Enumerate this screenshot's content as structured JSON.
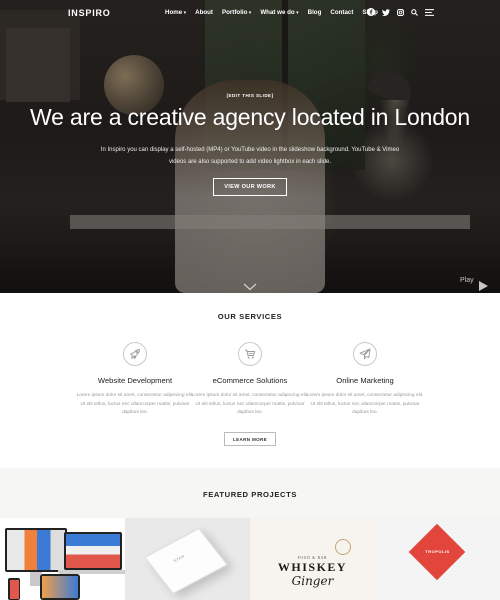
{
  "brand": {
    "logo_text": "INSPIRO"
  },
  "nav": {
    "items": [
      {
        "label": "Home",
        "dropdown": true
      },
      {
        "label": "About",
        "dropdown": false
      },
      {
        "label": "Portfolio",
        "dropdown": true
      },
      {
        "label": "What we do",
        "dropdown": true
      },
      {
        "label": "Blog",
        "dropdown": false
      },
      {
        "label": "Contact",
        "dropdown": false
      },
      {
        "label": "Shop",
        "dropdown": false
      }
    ],
    "icons": [
      "facebook-icon",
      "twitter-icon",
      "instagram-icon",
      "search-icon",
      "menu-icon"
    ]
  },
  "hero": {
    "edit_label": "[EDIT THIS SLIDE]",
    "title": "We are a creative agency located in London",
    "description": "In Inspiro you can display a self-hosted (MP4) or YouTube video in the slideshow background. YouTube & Vimeo videos are also supported to add video lightbox in each slide.",
    "button_label": "VIEW OUR WORK",
    "play_label": "Play"
  },
  "services": {
    "title": "OUR SERVICES",
    "items": [
      {
        "icon": "rocket-icon",
        "title": "Website Development",
        "text": "Lorem ipsum dolor sit amet, consectetur adipiscing elit. Ut elit tellus, luctus nec ullamcorper mattis, pulvinar dapibus leo."
      },
      {
        "icon": "cart-icon",
        "title": "eCommerce Solutions",
        "text": "Lorem ipsum dolor sit amet, consectetur adipiscing elit. Ut elit tellus, luctus nec ullamcorper mattis, pulvinar dapibus leo."
      },
      {
        "icon": "paper-plane-icon",
        "title": "Online Marketing",
        "text": "Lorem ipsum dolor sit amet, consectetur adipiscing elit. Ut elit tellus, luctus nec ullamcorper mattis, pulvinar dapibus leo."
      }
    ],
    "button_label": "LEARN MORE"
  },
  "featured": {
    "title": "FEATURED PROJECTS",
    "projects": [
      {
        "name": "devices-mockup"
      },
      {
        "name": "book-mockup",
        "label": "STAR"
      },
      {
        "name": "whiskey-ginger",
        "small": "FOOD & BAR",
        "big": "WHISKEY",
        "script": "Ginger"
      },
      {
        "name": "tropolis",
        "label": "TROPOLIS"
      }
    ]
  },
  "colors": {
    "accent": "#e2453c",
    "hero_overlay": "#000000",
    "muted_text": "#999999"
  }
}
